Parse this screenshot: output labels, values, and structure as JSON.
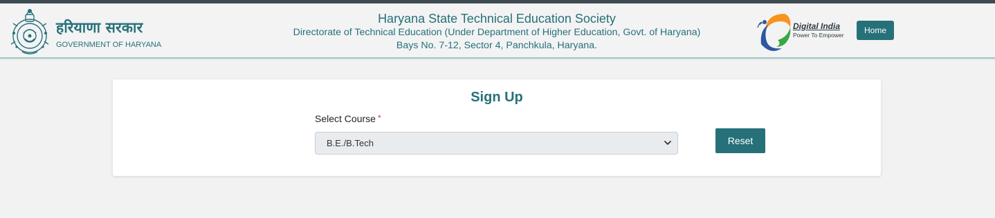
{
  "header": {
    "brand_hindi": "हरियाणा सरकार",
    "brand_english": "GOVERNMENT OF HARYANA",
    "title": "Haryana State Technical Education Society",
    "subtitle": "Directorate of Technical Education (Under Department of Higher Education, Govt. of Haryana)",
    "address": "Bays No. 7-12, Sector 4, Panchkula, Haryana.",
    "digital_india_title": "Digital India",
    "digital_india_tagline": "Power To Empower",
    "home_label": "Home"
  },
  "form": {
    "title": "Sign Up",
    "course_label": "Select Course",
    "required_mark": "*",
    "course_selected": "B.E./B.Tech",
    "reset_label": "Reset"
  },
  "icons": {
    "emblem": "haryana-emblem-icon",
    "digital_india": "digital-india-logo",
    "dropdown": "chevron-down-icon"
  },
  "colors": {
    "brand_teal": "#26707a",
    "top_bar": "#3d4a52",
    "page_bg": "#f2f2f2",
    "required": "#e03030"
  }
}
